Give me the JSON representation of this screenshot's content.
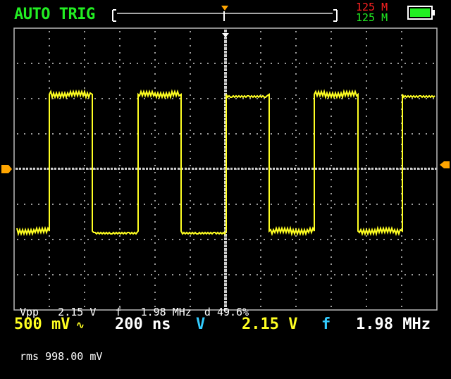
{
  "header": {
    "mode": "AUTO TRIG",
    "mem_top": "125 M",
    "mem_bottom": "125 M",
    "colors": {
      "mode": "#22ee22",
      "mem_top": "#ff2222",
      "mem_bottom": "#22ee22",
      "trace": "#ffff22",
      "marker": "#ffa500"
    }
  },
  "measurements": {
    "line1": "Vpp   2.15 V   f   1.98 MHz  d 49.6%",
    "line2": "rms 998.00 mV"
  },
  "footer": {
    "vdiv": "500 mV",
    "coupling_icon": "ac-coupling-icon",
    "timebase": "200 ns",
    "v_label": "V",
    "v_value": "2.15 V",
    "f_label": "f",
    "f_value": "1.98 MHz"
  },
  "battery": {
    "icon": "battery-full-icon",
    "level": 1.0
  }
}
